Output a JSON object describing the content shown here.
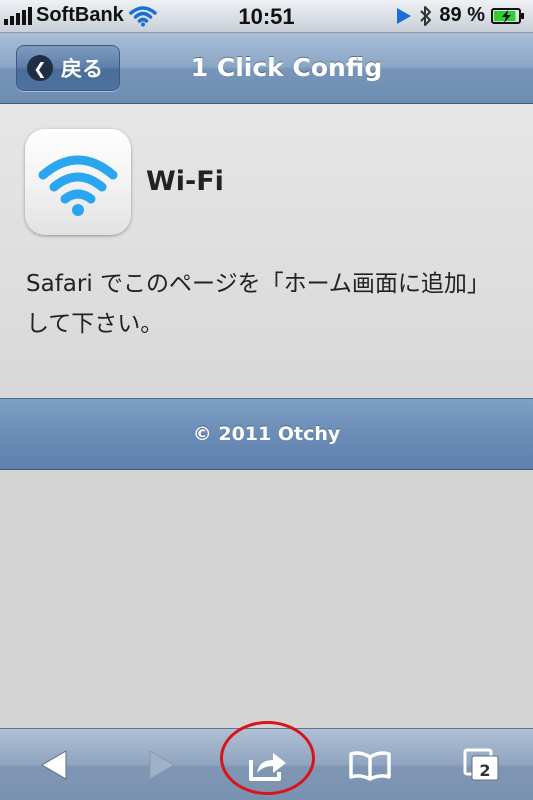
{
  "status_bar": {
    "carrier": "SoftBank",
    "time": "10:51",
    "battery_percent": "89 %",
    "battery_level": 0.89
  },
  "nav": {
    "back_label": "戻る",
    "title": "1 Click Config"
  },
  "content": {
    "app_name": "Wi-Fi",
    "app_icon": "wifi-icon",
    "instruction": "Safari でこのページを「ホーム画面に追加」して下さい。"
  },
  "footer": {
    "copyright": "© 2011 Otchy"
  },
  "toolbar": {
    "tab_count": "2",
    "icons": [
      "back-arrow-icon",
      "forward-arrow-icon",
      "share-icon",
      "bookmarks-icon",
      "tabs-icon"
    ]
  },
  "colors": {
    "nav_blue": "#7795b8",
    "annotation_red": "#d9141b",
    "wifi_blue": "#2aa6f0"
  }
}
